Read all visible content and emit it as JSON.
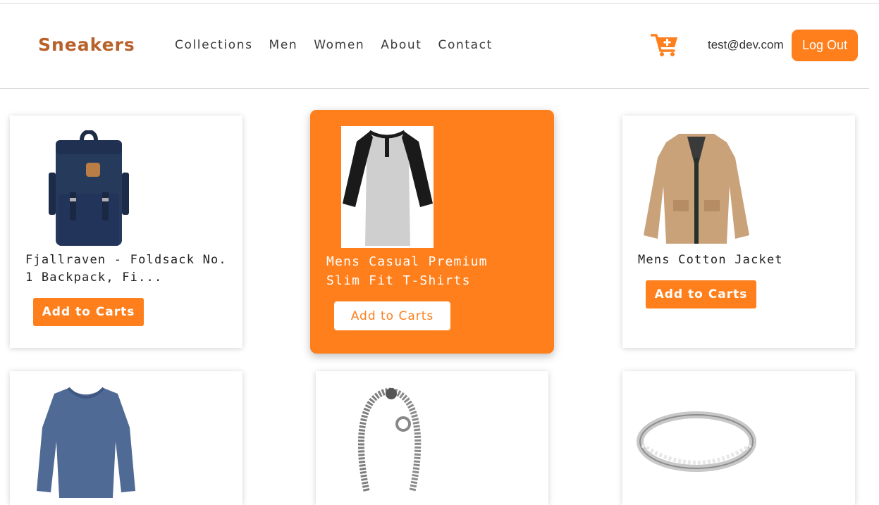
{
  "brand": "Sneakers",
  "nav": [
    "Collections",
    "Men",
    "Women",
    "About",
    "Contact"
  ],
  "user": {
    "email": "test@dev.com",
    "logout_label": "Log Out"
  },
  "colors": {
    "accent": "#fe7f1c",
    "brand": "#b8612a"
  },
  "icons": {
    "cart": "cart-plus-icon"
  },
  "products": [
    {
      "title": "Fjallraven - Foldsack No. 1 Backpack, Fi...",
      "button": "Add to Carts",
      "image": "backpack",
      "highlighted": false
    },
    {
      "title": "Mens Casual Premium Slim Fit T-Shirts",
      "button": "Add to Carts",
      "image": "raglan-tshirt",
      "highlighted": true
    },
    {
      "title": "Mens Cotton Jacket",
      "button": "Add to Carts",
      "image": "jacket",
      "highlighted": false
    },
    {
      "title": "",
      "button": "",
      "image": "long-sleeve-shirt",
      "highlighted": false
    },
    {
      "title": "",
      "button": "",
      "image": "dragon-bracelet",
      "highlighted": false
    },
    {
      "title": "",
      "button": "",
      "image": "silver-ring",
      "highlighted": false
    }
  ]
}
